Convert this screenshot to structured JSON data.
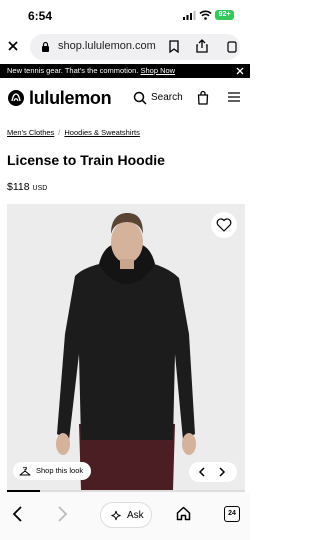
{
  "status": {
    "time": "6:54",
    "battery": "92+"
  },
  "browser": {
    "url": "shop.lululemon.com"
  },
  "promo": {
    "text": "New tennis gear. That's the commotion.",
    "link": "Shop Now"
  },
  "header": {
    "brand": "lululemon",
    "search_label": "Search"
  },
  "breadcrumb": {
    "items": [
      "Men's Clothes",
      "Hoodies & Sweatshirts"
    ]
  },
  "product": {
    "title": "License to Train Hoodie",
    "price": "$118",
    "currency": "USD"
  },
  "gallery": {
    "shop_look_label": "Shop this look",
    "progress_fraction": 0.14
  },
  "toolbar": {
    "ask_label": "Ask",
    "tab_count": "24"
  },
  "colors": {
    "banner": "#000000",
    "image_bg": "#ececec",
    "battery": "#34c759"
  }
}
